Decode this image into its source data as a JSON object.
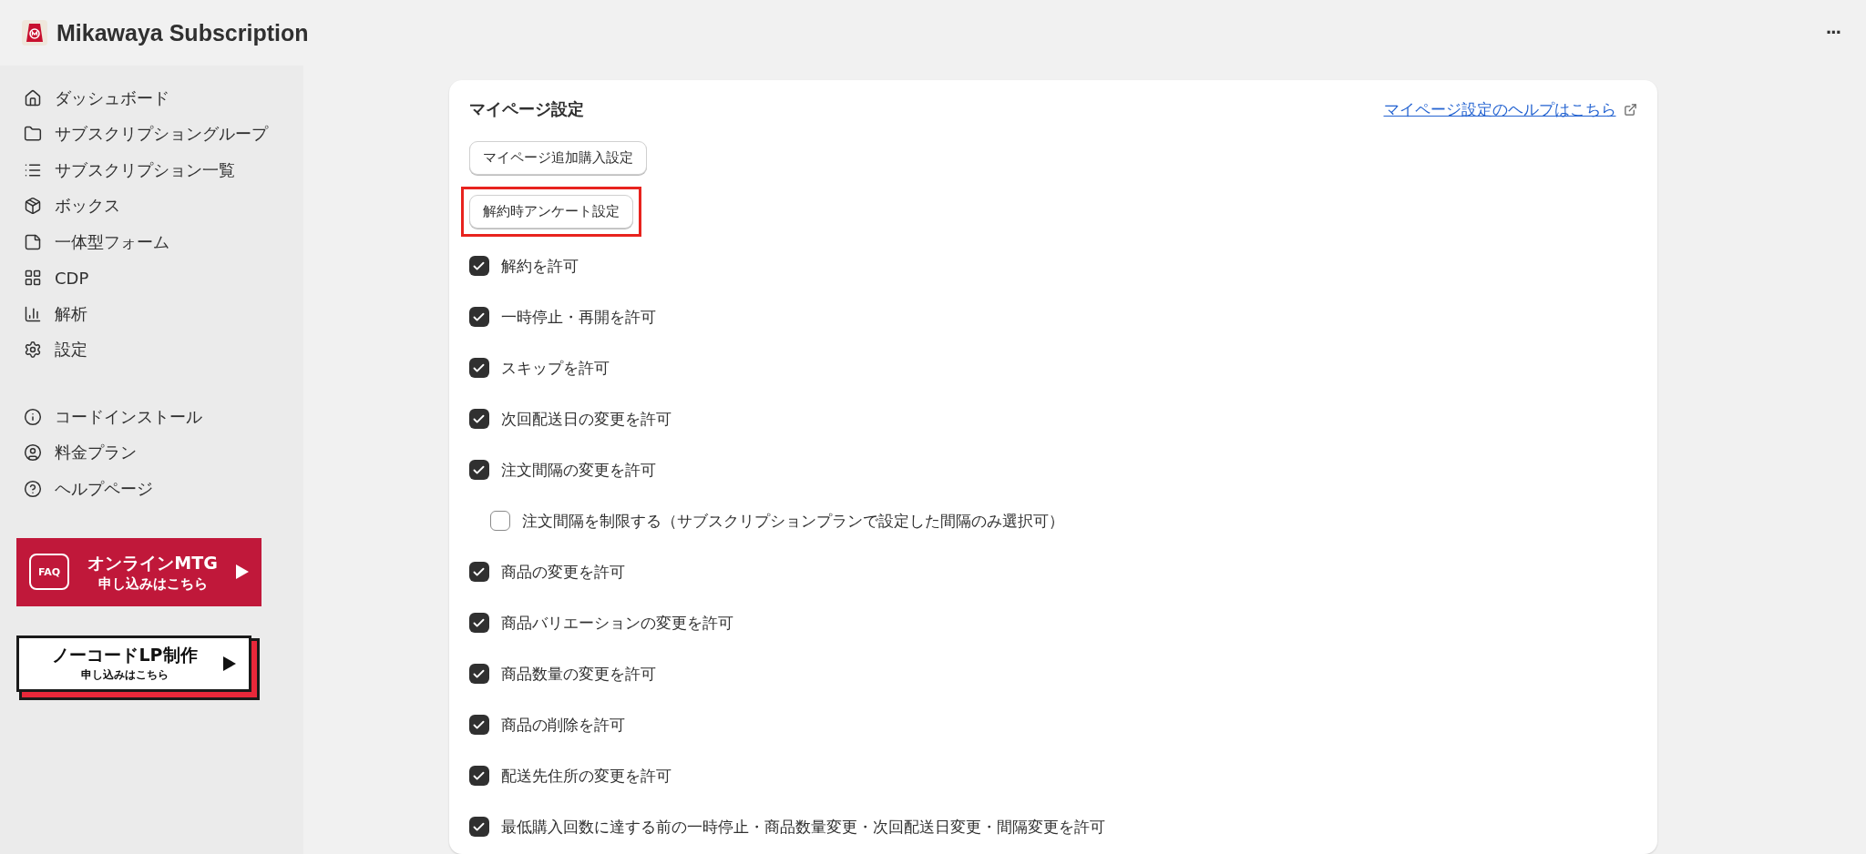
{
  "app": {
    "title": "Mikawaya Subscription",
    "more": "···"
  },
  "sidebar": {
    "groups": [
      [
        {
          "label": "ダッシュボード"
        },
        {
          "label": "サブスクリプショングループ"
        },
        {
          "label": "サブスクリプション一覧"
        },
        {
          "label": "ボックス"
        },
        {
          "label": "一体型フォーム"
        },
        {
          "label": "CDP"
        },
        {
          "label": "解析"
        },
        {
          "label": "設定"
        }
      ],
      [
        {
          "label": "コードインストール"
        },
        {
          "label": "料金プラン"
        },
        {
          "label": "ヘルプページ"
        }
      ]
    ],
    "banners": [
      {
        "kind": "faq",
        "badge": "FAQ",
        "title": "オンラインMTG",
        "subtitle": "申し込みはこちら"
      },
      {
        "kind": "lp",
        "title": "ノーコードLP制作",
        "subtitle": "申し込みはこちら"
      }
    ]
  },
  "card": {
    "title": "マイページ設定",
    "help_link": "マイページ設定のヘルプはこちら",
    "buttons": [
      {
        "label": "マイページ追加購入設定",
        "highlighted": false
      },
      {
        "label": "解約時アンケート設定",
        "highlighted": true
      }
    ],
    "options": [
      {
        "label": "解約を許可",
        "checked": true
      },
      {
        "label": "一時停止・再開を許可",
        "checked": true
      },
      {
        "label": "スキップを許可",
        "checked": true
      },
      {
        "label": "次回配送日の変更を許可",
        "checked": true
      },
      {
        "label": "注文間隔の変更を許可",
        "checked": true,
        "children": [
          {
            "label": "注文間隔を制限する（サブスクリプションプランで設定した間隔のみ選択可）",
            "checked": false
          }
        ]
      },
      {
        "label": "商品の変更を許可",
        "checked": true
      },
      {
        "label": "商品バリエーションの変更を許可",
        "checked": true
      },
      {
        "label": "商品数量の変更を許可",
        "checked": true
      },
      {
        "label": "商品の削除を許可",
        "checked": true
      },
      {
        "label": "配送先住所の変更を許可",
        "checked": true
      },
      {
        "label": "最低購入回数に達する前の一時停止・商品数量変更・次回配送日変更・間隔変更を許可",
        "checked": true
      }
    ]
  }
}
